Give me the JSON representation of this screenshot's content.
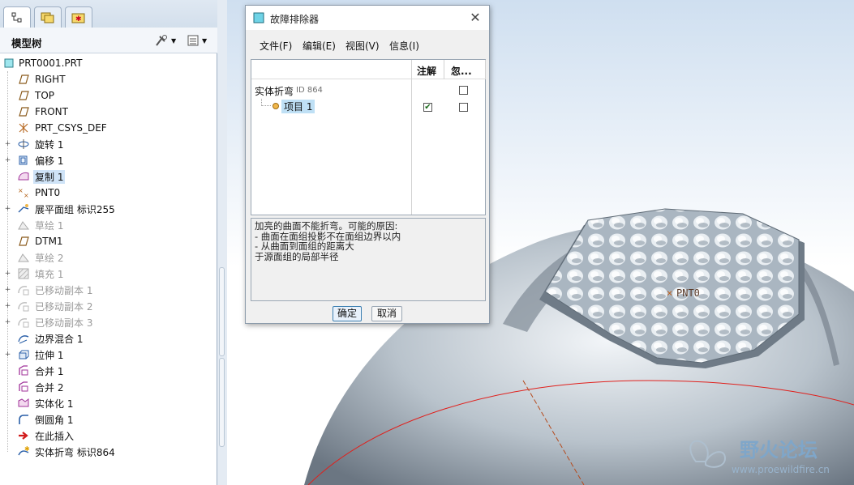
{
  "left_panel": {
    "tabs": [
      {
        "name": "model-tree-tab",
        "icon": "tree-icon"
      },
      {
        "name": "folder-tab",
        "icon": "folders-icon"
      },
      {
        "name": "favorites-tab",
        "icon": "star-folder-icon"
      }
    ],
    "tree_title": "模型树",
    "root": "PRT0001.PRT",
    "items": [
      {
        "label": "RIGHT",
        "icon": "datum-plane-icon",
        "state": "normal",
        "expandable": false
      },
      {
        "label": "TOP",
        "icon": "datum-plane-icon",
        "state": "normal",
        "expandable": false
      },
      {
        "label": "FRONT",
        "icon": "datum-plane-icon",
        "state": "normal",
        "expandable": false
      },
      {
        "label": "PRT_CSYS_DEF",
        "icon": "csys-icon",
        "state": "normal",
        "expandable": false
      },
      {
        "label": "旋转 1",
        "icon": "revolve-icon",
        "state": "normal",
        "expandable": true
      },
      {
        "label": "偏移 1",
        "icon": "offset-icon",
        "state": "normal",
        "expandable": true
      },
      {
        "label": "复制 1",
        "icon": "copy-surface-icon",
        "state": "selected",
        "expandable": false
      },
      {
        "label": "PNT0",
        "icon": "datum-point-icon",
        "state": "normal",
        "expandable": false
      },
      {
        "label": "展平面组 标识255",
        "icon": "flatten-quilt-icon",
        "state": "normal",
        "expandable": true
      },
      {
        "label": "草绘 1",
        "icon": "sketch-icon",
        "state": "dim",
        "expandable": false
      },
      {
        "label": "DTM1",
        "icon": "datum-plane-icon",
        "state": "normal",
        "expandable": false
      },
      {
        "label": "草绘 2",
        "icon": "sketch-icon",
        "state": "dim",
        "expandable": false
      },
      {
        "label": "填充 1",
        "icon": "fill-icon",
        "state": "dim",
        "expandable": true
      },
      {
        "label": "已移动副本 1",
        "icon": "moved-copy-icon",
        "state": "dim",
        "expandable": true
      },
      {
        "label": "已移动副本 2",
        "icon": "moved-copy-icon",
        "state": "dim",
        "expandable": true
      },
      {
        "label": "已移动副本 3",
        "icon": "moved-copy-icon",
        "state": "dim",
        "expandable": true
      },
      {
        "label": "边界混合 1",
        "icon": "boundary-blend-icon",
        "state": "normal",
        "expandable": false
      },
      {
        "label": "拉伸 1",
        "icon": "extrude-icon",
        "state": "normal",
        "expandable": true
      },
      {
        "label": "合并 1",
        "icon": "merge-icon",
        "state": "normal",
        "expandable": false
      },
      {
        "label": "合并 2",
        "icon": "merge-icon",
        "state": "normal",
        "expandable": false
      },
      {
        "label": "实体化 1",
        "icon": "solidify-icon",
        "state": "normal",
        "expandable": false
      },
      {
        "label": "倒圆角 1",
        "icon": "round-icon",
        "state": "normal",
        "expandable": false
      },
      {
        "label": "在此插入",
        "icon": "insert-here-icon",
        "state": "normal",
        "expandable": false
      },
      {
        "label": "实体折弯 标识864",
        "icon": "solid-bend-icon",
        "state": "normal",
        "expandable": false
      }
    ]
  },
  "dialog": {
    "title": "故障排除器",
    "menus": [
      "文件(F)",
      "编辑(E)",
      "视图(V)",
      "信息(I)"
    ],
    "columns": {
      "note": "注解",
      "ignore": "忽..."
    },
    "rows": [
      {
        "label": "实体折弯",
        "tag": "ID 864",
        "note_checked": null,
        "ignore_checked": false
      },
      {
        "label": "项目 1",
        "tag": "",
        "note_checked": true,
        "ignore_checked": false
      }
    ],
    "message": [
      "加亮的曲面不能折弯。可能的原因:",
      "- 曲面在面组投影不在面组边界以内",
      "- 从曲面到面组的距离大",
      "于源面组的局部半径"
    ],
    "ok_label": "确定",
    "cancel_label": "取消"
  },
  "viewport": {
    "point_label": "PNT0"
  },
  "watermark": {
    "title": "野火论坛",
    "url": "www.proewildfire.cn"
  }
}
